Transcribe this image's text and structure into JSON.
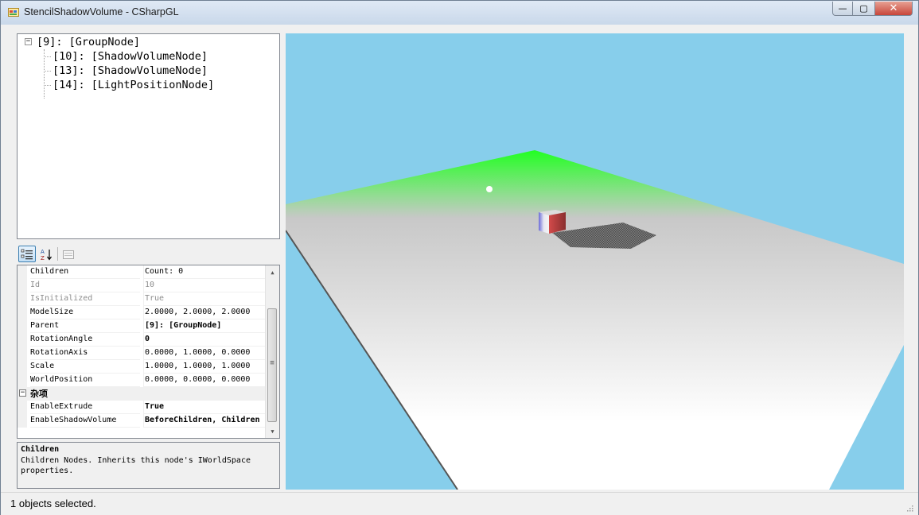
{
  "window": {
    "title": "StencilShadowVolume - CSharpGL",
    "minimize_glyph": "—",
    "maximize_glyph": "▢",
    "close_glyph": "✕"
  },
  "tree": {
    "root": {
      "label": "[9]: [GroupNode]",
      "toggle": "−"
    },
    "children": [
      {
        "label": "[10]: [ShadowVolumeNode]"
      },
      {
        "label": "[13]: [ShadowVolumeNode]"
      },
      {
        "label": "[14]: [LightPositionNode]"
      }
    ]
  },
  "toolbar": {
    "categorized_icon": "categorized-view-icon",
    "alphabetical_icon": "alphabetical-sort-icon",
    "property_pages_icon": "property-pages-icon"
  },
  "property_grid": {
    "rows": [
      {
        "name": "Children",
        "value": "Count: 0"
      },
      {
        "name": "Id",
        "value": "10"
      },
      {
        "name": "IsInitialized",
        "value": "True"
      },
      {
        "name": "ModelSize",
        "value": "2.0000, 2.0000, 2.0000"
      },
      {
        "name": "Parent",
        "value": "[9]: [GroupNode]"
      },
      {
        "name": "RotationAngle",
        "value": "0"
      },
      {
        "name": "RotationAxis",
        "value": "0.0000, 1.0000, 0.0000"
      },
      {
        "name": "Scale",
        "value": "1.0000, 1.0000, 1.0000"
      },
      {
        "name": "WorldPosition",
        "value": "0.0000, 0.0000, 0.0000"
      }
    ],
    "category": {
      "label": "杂项",
      "toggle": "−"
    },
    "category_rows": [
      {
        "name": "EnableExtrude",
        "value": "True"
      },
      {
        "name": "EnableShadowVolume",
        "value": "BeforeChildren, Children"
      }
    ],
    "scroll_up": "▲",
    "scroll_down": "▼",
    "scroll_grip": "≡"
  },
  "help": {
    "title": "Children",
    "description": "Children Nodes. Inherits this node's IWorldSpace properties."
  },
  "viewport": {
    "sky_color": "#87ceeb",
    "ground_far_color": "#22ff22",
    "ground_near_color": "#ffffff"
  },
  "status": {
    "text": "1 objects selected."
  }
}
